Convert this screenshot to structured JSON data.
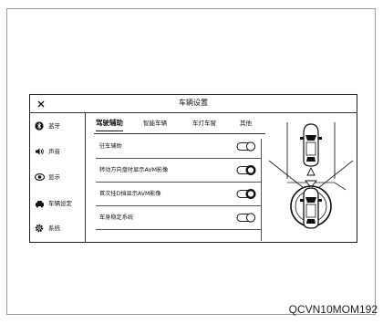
{
  "window": {
    "title": "车辆设置"
  },
  "sidebar": {
    "items": [
      {
        "icon": "bluetooth-icon",
        "label": "蓝牙"
      },
      {
        "icon": "speaker-icon",
        "label": "声音"
      },
      {
        "icon": "eye-icon",
        "label": "显示"
      },
      {
        "icon": "car-icon",
        "label": "车辆设定"
      },
      {
        "icon": "gear-icon",
        "label": "系统"
      }
    ]
  },
  "tabs": [
    {
      "label": "驾驶辅助",
      "active": true
    },
    {
      "label": "智能车辆",
      "active": false
    },
    {
      "label": "车灯车窗",
      "active": false
    },
    {
      "label": "其他",
      "active": false
    }
  ],
  "settings": [
    {
      "label": "驻车辅助",
      "state": "off"
    },
    {
      "label": "转动方向盘时显示AVM影像",
      "state": "on"
    },
    {
      "label": "首次挂D挡显示AVM影像",
      "state": "on"
    },
    {
      "label": "车身稳定系统",
      "state": "off"
    }
  ],
  "footer": {
    "code": "QCVN10MOM192"
  }
}
